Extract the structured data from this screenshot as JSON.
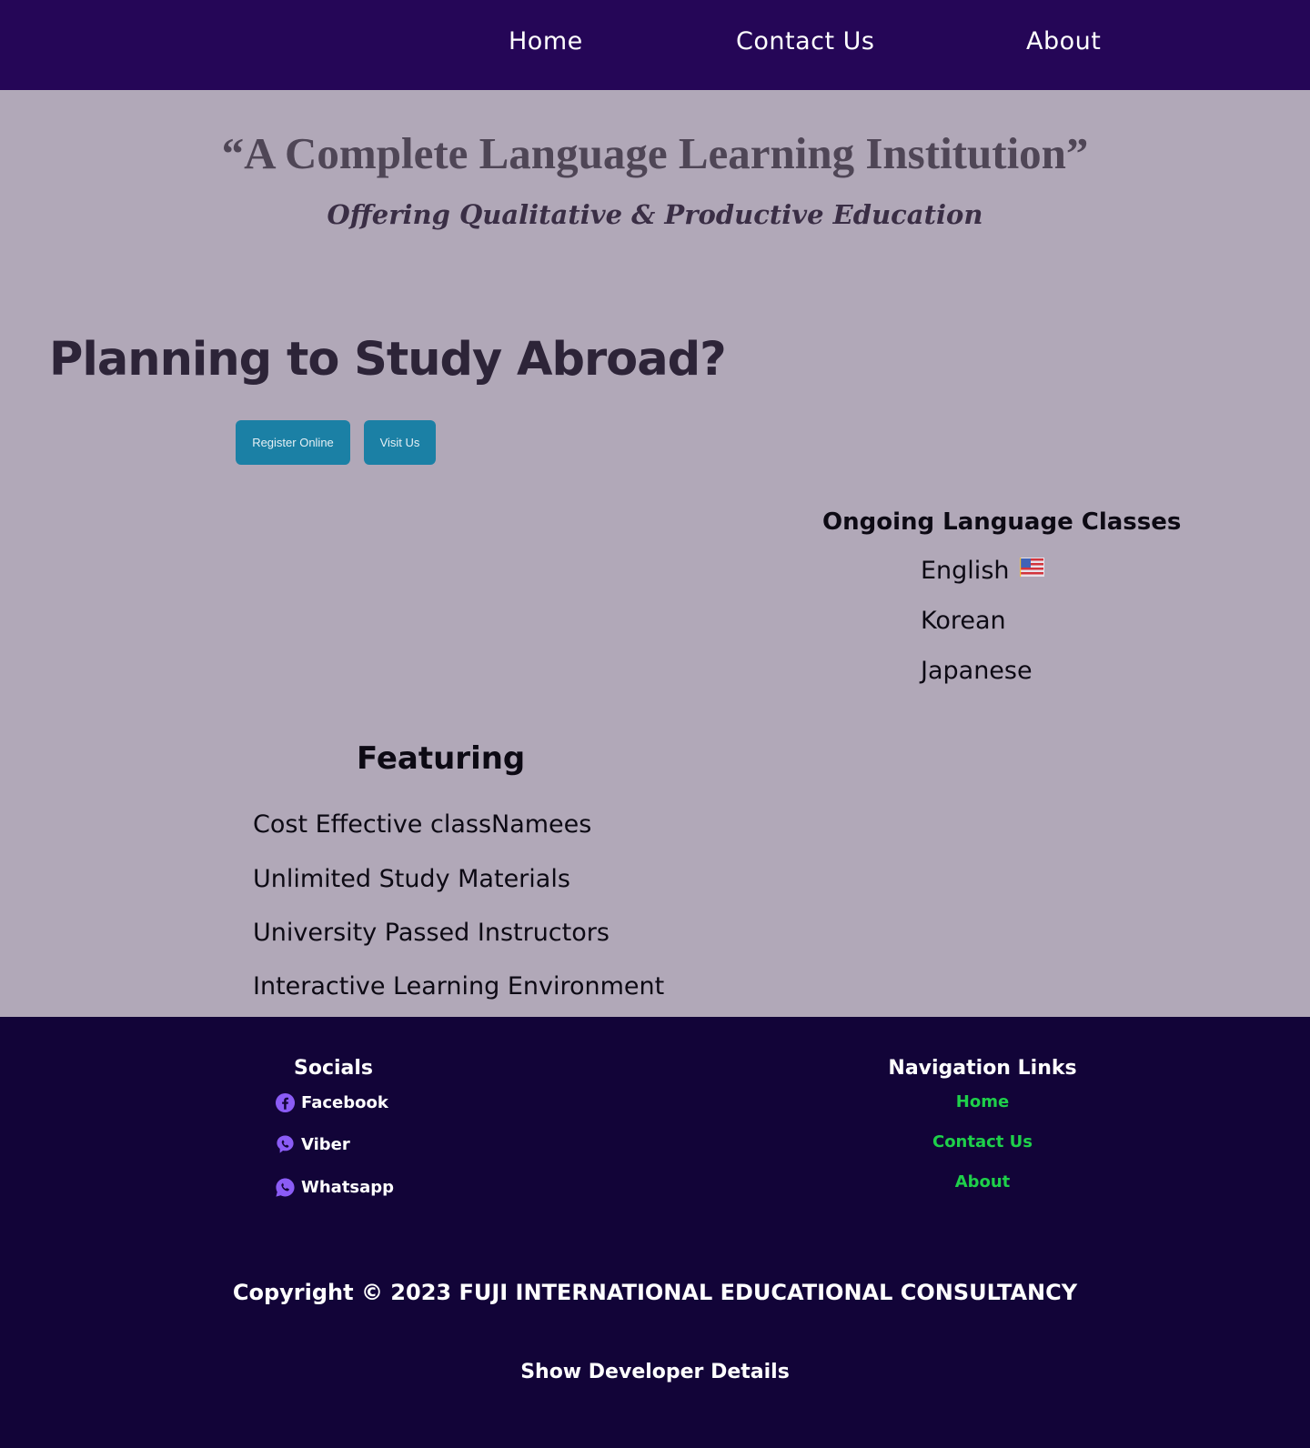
{
  "nav": {
    "items": [
      {
        "label": "Home"
      },
      {
        "label": "Contact Us"
      },
      {
        "label": "About"
      }
    ]
  },
  "hero": {
    "quote": "“A Complete Language Learning Institution”",
    "subtitle": "Offering Qualitative & Productive Education"
  },
  "study": {
    "title": "Planning to Study Abroad?",
    "register_label": "Register Online",
    "visit_label": "Visit Us"
  },
  "classes": {
    "title": "Ongoing Language Classes",
    "items": [
      "English",
      "Korean",
      "Japanese"
    ],
    "flag_icon": "us-flag-icon"
  },
  "featuring": {
    "title": "Featuring",
    "items": [
      "Cost Effective classNamees",
      "Unlimited Study Materials",
      "University Passed Instructors",
      "Interactive Learning Environment"
    ]
  },
  "footer": {
    "socials_title": "Socials",
    "socials": [
      {
        "label": "Facebook",
        "icon": "facebook-icon"
      },
      {
        "label": "Viber",
        "icon": "viber-icon"
      },
      {
        "label": "Whatsapp",
        "icon": "whatsapp-icon"
      }
    ],
    "navlinks_title": "Navigation Links",
    "navlinks": [
      {
        "label": "Home"
      },
      {
        "label": "Contact Us"
      },
      {
        "label": "About"
      }
    ],
    "copyright": "Copyright © 2023 FUJI INTERNATIONAL EDUCATIONAL CONSULTANCY",
    "developer_label": "Show Developer Details"
  },
  "colors": {
    "nav_bg": "#250657",
    "page_bg": "#b1a8b8",
    "footer_bg": "#120438",
    "button_bg": "#1b80a5",
    "footer_link": "#1ed04a",
    "social_icon": "#8b5cf6"
  }
}
